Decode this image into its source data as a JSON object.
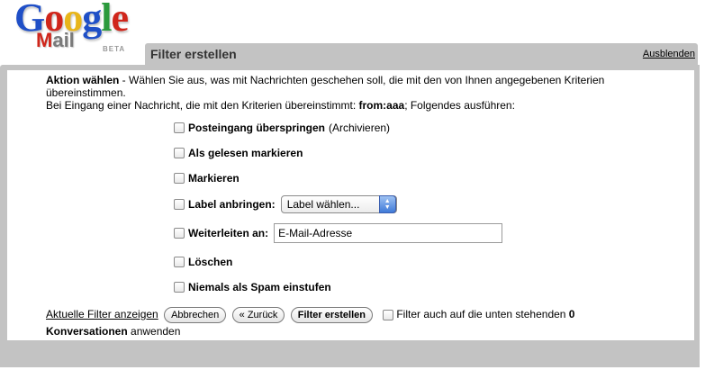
{
  "logo": {
    "google_letters": [
      "G",
      "o",
      "o",
      "g",
      "l",
      "e"
    ],
    "mail_letters": [
      "M",
      "ail"
    ],
    "beta": "BETA"
  },
  "header": {
    "title": "Filter erstellen",
    "hide_link": "Ausblenden"
  },
  "description": {
    "action_label": "Aktion wählen",
    "action_text": " - Wählen Sie aus, was mit Nachrichten geschehen soll, die mit den von Ihnen angegebenen Kriterien übereinstimmen.",
    "criteria_prefix": "Bei Eingang einer Nachricht, die mit den Kriterien übereinstimmt: ",
    "criteria_value": "from:aaa",
    "criteria_suffix": "; Folgendes ausführen:"
  },
  "options": {
    "skip_inbox": {
      "label": "Posteingang überspringen",
      "note": "(Archivieren)"
    },
    "mark_read": {
      "label": "Als gelesen markieren"
    },
    "star": {
      "label": "Markieren"
    },
    "apply_label": {
      "label": "Label anbringen:",
      "select_value": "Label wählen..."
    },
    "forward": {
      "label": "Weiterleiten an:",
      "input_value": "E-Mail-Adresse"
    },
    "delete": {
      "label": "Löschen"
    },
    "never_spam": {
      "label": "Niemals als Spam einstufen"
    }
  },
  "footer": {
    "show_filters_link": "Aktuelle Filter anzeigen",
    "cancel_button": "Abbrechen",
    "back_button": "« Zurück",
    "create_button": "Filter erstellen",
    "apply_text": "Filter auch auf die unten stehenden ",
    "apply_count": "0",
    "apply_word": "Konversationen",
    "apply_suffix": " anwenden"
  },
  "colors": {
    "frame_gray": "#c3c3c3",
    "logo_blue": "#1f4fc7",
    "logo_red": "#d0261b",
    "logo_yellow": "#e8b51a",
    "logo_green": "#2b9a3c"
  }
}
